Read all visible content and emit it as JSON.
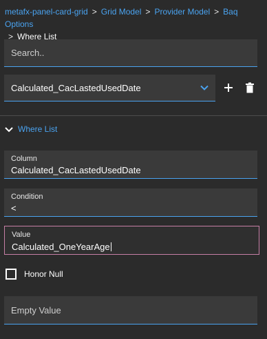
{
  "breadcrumb": {
    "items": [
      "metafx-panel-card-grid",
      "Grid Model",
      "Provider Model",
      "Baq Options"
    ],
    "current": "Where List",
    "separator": ">"
  },
  "search": {
    "placeholder": "Search.."
  },
  "selector": {
    "value": "Calculated_CacLastedUsedDate"
  },
  "section": {
    "title": "Where List",
    "expanded": true
  },
  "fields": {
    "column": {
      "label": "Column",
      "value": "Calculated_CacLastedUsedDate"
    },
    "condition": {
      "label": "Condition",
      "value": "<"
    },
    "value": {
      "label": "Value",
      "value": "Calculated_OneYearAge"
    }
  },
  "honor_null": {
    "label": "Honor Null",
    "checked": false
  },
  "empty_value": {
    "placeholder": "Empty Value"
  },
  "icons": {
    "dropdown": "chevron-down-icon",
    "add": "plus-icon",
    "delete": "trash-icon",
    "section_toggle": "chevron-down-icon"
  },
  "colors": {
    "accent": "#4aa3f0",
    "focus": "#c77fa6",
    "background": "#2b2b2b",
    "field": "#3a3a3a"
  }
}
